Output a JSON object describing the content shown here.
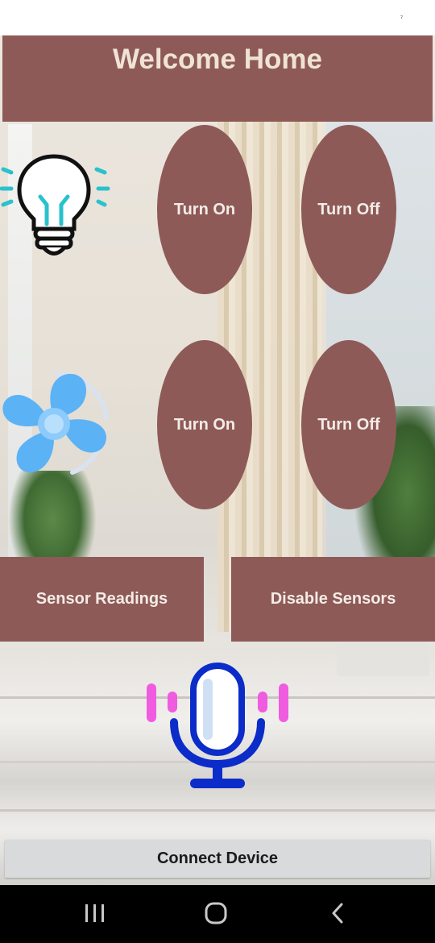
{
  "status_bar": {
    "indicator": "⁷"
  },
  "header": {
    "title": "Welcome Home"
  },
  "light": {
    "icon": "lightbulb-icon",
    "on_label": "Turn On",
    "off_label": "Turn Off"
  },
  "fan": {
    "icon": "fan-icon",
    "on_label": "Turn On",
    "off_label": "Turn Off"
  },
  "sensors": {
    "readings_label": "Sensor Readings",
    "disable_label": "Disable Sensors"
  },
  "voice": {
    "icon": "microphone-icon"
  },
  "connect": {
    "label": "Connect Device"
  },
  "nav": {
    "recents": "recents-icon",
    "home": "home-icon",
    "back": "back-icon"
  },
  "colors": {
    "button": "#8e5a58",
    "button_text": "#f3ece6",
    "mic_blue": "#0b2cc9",
    "mic_pink": "#f05ce0"
  }
}
